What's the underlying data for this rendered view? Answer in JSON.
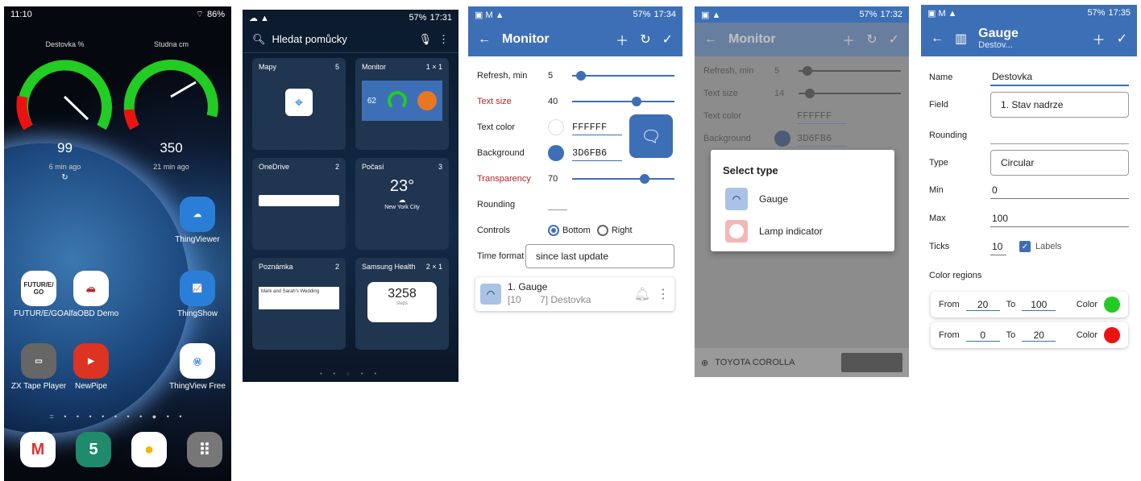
{
  "p1": {
    "time": "11:10",
    "battery": "86%",
    "g1": {
      "title": "Destovka %",
      "value": "99",
      "ago": "6 min ago"
    },
    "g2": {
      "title": "Studna cm",
      "value": "350",
      "ago": "21 min ago"
    },
    "apps": [
      {
        "label": "ThingViewer"
      },
      {
        "label": "FUTUR/E/GO"
      },
      {
        "label": "AlfaOBD Demo"
      },
      {
        "label": "ThingShow"
      },
      {
        "label": "ZX Tape Player"
      },
      {
        "label": "NewPipe"
      },
      {
        "label": "ThingView Free"
      }
    ],
    "futur_logo": "FUTUR/E/\nGO",
    "calendar_day": "5"
  },
  "p2": {
    "time": "17:31",
    "battery": "57%",
    "search": "Hledat pomůcky",
    "widgets": [
      {
        "name": "Mapy",
        "count": "5"
      },
      {
        "name": "Monitor",
        "count": "1 × 1",
        "val": "62"
      },
      {
        "name": "OneDrive",
        "count": "2"
      },
      {
        "name": "Počasí",
        "count": "3",
        "temp": "23°",
        "city": "New York City"
      },
      {
        "name": "Poznámka",
        "count": "2",
        "note": "Mark and Sarah's Wedding"
      },
      {
        "name": "Samsung Health",
        "count": "2 × 1",
        "steps": "3258",
        "steps_label": "steps"
      }
    ]
  },
  "p3": {
    "time": "17:34",
    "battery": "57%",
    "title": "Monitor",
    "refresh_label": "Refresh, min",
    "refresh_val": "5",
    "textsize_label": "Text size",
    "textsize_val": "40",
    "textcolor_label": "Text color",
    "textcolor_val": "FFFFFF",
    "bg_label": "Background",
    "bg_val": "3D6FB6",
    "transp_label": "Transparency",
    "transp_val": "70",
    "rounding_label": "Rounding",
    "controls_label": "Controls",
    "ctl_bottom": "Bottom",
    "ctl_right": "Right",
    "timefmt_label": "Time format",
    "timefmt_val": "since last update",
    "item_title": "1. Gauge",
    "item_sub": "[10       7] Destovka"
  },
  "p4": {
    "time": "17:32",
    "battery": "57%",
    "title": "Monitor",
    "refresh_label": "Refresh, min",
    "refresh_val": "5",
    "textsize_label": "Text size",
    "textsize_val": "14",
    "textcolor_label": "Text color",
    "textcolor_val": "FFFFFF",
    "bg_label": "Background",
    "bg_val": "3D6FB6",
    "dialog_title": "Select type",
    "opt1": "Gauge",
    "opt2": "Lamp indicator",
    "ad": "TOYOTA COROLLA"
  },
  "p5": {
    "time": "17:35",
    "battery": "57%",
    "title": "Gauge",
    "subtitle": "Destov...",
    "name_label": "Name",
    "name_val": "Destovka",
    "field_label": "Field",
    "field_val": "1. Stav nadrze",
    "rounding_label": "Rounding",
    "type_label": "Type",
    "type_val": "Circular",
    "min_label": "Min",
    "min_val": "0",
    "max_label": "Max",
    "max_val": "100",
    "ticks_label": "Ticks",
    "ticks_val": "10",
    "labels_label": "Labels",
    "colreg_label": "Color regions",
    "regions": [
      {
        "from_label": "From",
        "from": "20",
        "to_label": "To",
        "to": "100",
        "color_label": "Color",
        "color": "#22cc22"
      },
      {
        "from_label": "From",
        "from": "0",
        "to_label": "To",
        "to": "20",
        "color_label": "Color",
        "color": "#ee1111"
      }
    ]
  },
  "colors": {
    "accent": "#3d6fb6",
    "green": "#22cc22",
    "red": "#ee1111"
  }
}
